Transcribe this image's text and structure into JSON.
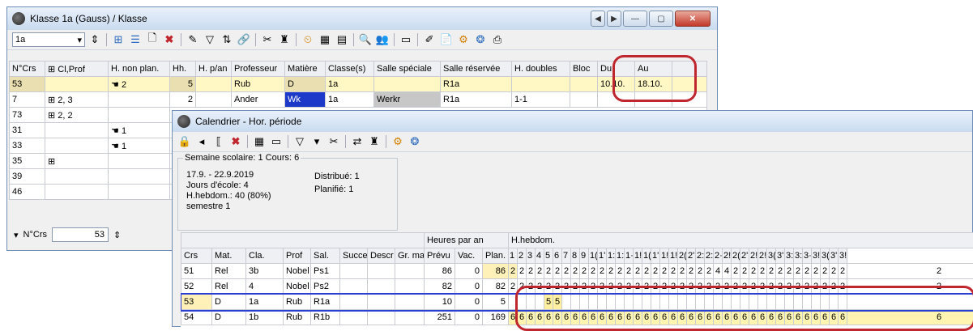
{
  "main_window": {
    "title": "Klasse 1a (Gauss) / Klasse",
    "class_select_value": "1a",
    "columns": [
      "N°Crs",
      "⊞ Cl,Prof",
      "H. non plan.",
      "Hh.",
      "H. p/an",
      "Professeur",
      "Matière",
      "Classe(s)",
      "Salle spéciale",
      "Salle réservée",
      "H. doubles",
      "Bloc",
      "Du",
      "Au"
    ],
    "rows": [
      {
        "ncrs": "53",
        "clprof": "",
        "hnonplan": "2",
        "hh": "5",
        "hpan": "",
        "prof": "Rub",
        "matiere": "D",
        "classes": "1a",
        "sallespec": "",
        "sallereserv": "R1a",
        "hdoubles": "",
        "bloc": "",
        "du": "10.10.",
        "au": "18.10."
      },
      {
        "ncrs": "7",
        "clprof": "⊞ 2, 3",
        "hnonplan": "",
        "hh": "2",
        "hpan": "",
        "prof": "Ander",
        "matiere": "Wk",
        "classes": "1a",
        "sallespec": "Werkr",
        "sallereserv": "R1a",
        "hdoubles": "1-1",
        "bloc": "",
        "du": "",
        "au": ""
      },
      {
        "ncrs": "73",
        "clprof": "⊞ 2, 2",
        "hnonplan": ""
      },
      {
        "ncrs": "31",
        "clprof": "",
        "hnonplan": "1"
      },
      {
        "ncrs": "33",
        "clprof": "",
        "hnonplan": "1"
      },
      {
        "ncrs": "35",
        "clprof": "⊞",
        "hnonplan": ""
      },
      {
        "ncrs": "39",
        "clprof": "",
        "hnonplan": ""
      },
      {
        "ncrs": "46",
        "clprof": "",
        "hnonplan": ""
      }
    ],
    "footer_label": "N°Crs",
    "footer_value": "53"
  },
  "calendar_window": {
    "title": "Calendrier - Hor. période",
    "info": {
      "group_label": "Semaine scolaire: 1  Cours: 6",
      "dates": "17.9. - 22.9.2019",
      "school_days": "Jours d'école: 4",
      "hebdom": "H.hebdom.: 40 (80%)",
      "semester": "semestre 1",
      "distributed": "Distribué: 1",
      "planned": "Planifié: 1"
    },
    "group_headers": {
      "heures": "Heures par an",
      "hebdom": "H.hebdom."
    },
    "columns": [
      "Crs",
      "Mat.",
      "Cla.",
      "Prof",
      "Sal.",
      "Succe",
      "Descr",
      "Gr. ma",
      "Prévu",
      "Vac.",
      "Plan."
    ],
    "week_numbers": [
      "1",
      "2",
      "3",
      "4",
      "5",
      "6",
      "7",
      "8",
      "9",
      "1(",
      "1'",
      "1:",
      "1:",
      "1·",
      "1!",
      "1(",
      "1'",
      "1!",
      "1!",
      "2(",
      "2'",
      "2:",
      "2:",
      "2·",
      "2!",
      "2(",
      "2'",
      "2!",
      "2!",
      "3(",
      "3'",
      "3:",
      "3:",
      "3·",
      "3!",
      "3(",
      "3'",
      "3!"
    ],
    "rows": [
      {
        "crs": "51",
        "mat": "Rel",
        "cla": "3b",
        "prof": "Nobel",
        "sal": "Ps1",
        "prevu": "86",
        "vac": "0",
        "plan": "86",
        "weeks": [
          "2",
          "2",
          "2",
          "2",
          "2",
          "2",
          "2",
          "2",
          "2",
          "2",
          "2",
          "2",
          "2",
          "2",
          "2",
          "2",
          "2",
          "2",
          "2",
          "2",
          "2",
          "2",
          "2",
          "4",
          "4",
          "2",
          "2",
          "2",
          "2",
          "2",
          "2",
          "2",
          "2",
          "2",
          "2",
          "2",
          "2",
          "2",
          "2"
        ]
      },
      {
        "crs": "52",
        "mat": "Rel",
        "cla": "4",
        "prof": "Nobel",
        "sal": "Ps2",
        "prevu": "82",
        "vac": "0",
        "plan": "82",
        "weeks": [
          "2",
          "2",
          "2",
          "2",
          "2",
          "2",
          "2",
          "2",
          "2",
          "2",
          "2",
          "2",
          "2",
          "2",
          "2",
          "2",
          "2",
          "2",
          "2",
          "2",
          "2",
          "2",
          "2",
          "2",
          "2",
          "2",
          "2",
          "2",
          "2",
          "2",
          "2",
          "2",
          "2",
          "2",
          "2",
          "2",
          "2",
          "2",
          "2"
        ]
      },
      {
        "crs": "53",
        "mat": "D",
        "cla": "1a",
        "prof": "Rub",
        "sal": "R1a",
        "prevu": "10",
        "vac": "0",
        "plan": "5",
        "weeks": [
          "",
          "",
          "",
          "",
          "5",
          "5",
          "",
          "",
          "",
          "",
          "",
          "",
          "",
          "",
          "",
          "",
          "",
          "",
          "",
          "",
          "",
          "",
          "",
          "",
          "",
          "",
          "",
          "",
          "",
          "",
          "",
          "",
          "",
          "",
          "",
          "",
          "",
          "",
          ""
        ]
      },
      {
        "crs": "54",
        "mat": "D",
        "cla": "1b",
        "prof": "Rub",
        "sal": "R1b",
        "prevu": "251",
        "vac": "0",
        "plan": "169",
        "weeks": [
          "6",
          "6",
          "6",
          "6",
          "6",
          "6",
          "6",
          "6",
          "6",
          "6",
          "6",
          "6",
          "6",
          "6",
          "6",
          "6",
          "6",
          "6",
          "6",
          "6",
          "6",
          "6",
          "6",
          "6",
          "6",
          "6",
          "6",
          "6",
          "6",
          "6",
          "6",
          "6",
          "6",
          "6",
          "6",
          "6",
          "6",
          "6",
          "6"
        ]
      }
    ]
  }
}
